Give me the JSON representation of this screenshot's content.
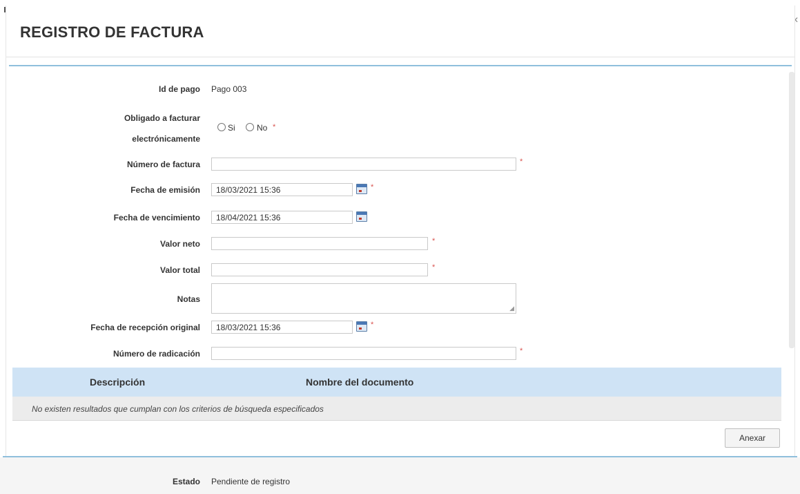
{
  "dialog": {
    "title": "REGISTRO DE FACTURA"
  },
  "fields": {
    "id_pago": {
      "label": "Id de pago",
      "value": "Pago 003"
    },
    "obligado": {
      "label_line1": "Obligado a facturar",
      "label_line2": "electrónicamente",
      "option_si": "Si",
      "option_no": "No"
    },
    "numero_factura": {
      "label": "Número de factura",
      "value": ""
    },
    "fecha_emision": {
      "label": "Fecha de emisión",
      "value": "18/03/2021 15:36"
    },
    "fecha_vencimiento": {
      "label": "Fecha de vencimiento",
      "value": "18/04/2021 15:36"
    },
    "valor_neto": {
      "label": "Valor neto",
      "value": ""
    },
    "valor_total": {
      "label": "Valor total",
      "value": ""
    },
    "notas": {
      "label": "Notas",
      "value": ""
    },
    "fecha_recepcion": {
      "label": "Fecha de recepción original",
      "value": "18/03/2021 15:36"
    },
    "numero_radicacion": {
      "label": "Número de radicación",
      "value": ""
    }
  },
  "required_mark": "*",
  "documents_table": {
    "columns": [
      "Descripción",
      "Nombre del documento"
    ],
    "empty_message": "No existen resultados que cumplan con los criterios de búsqueda especificados"
  },
  "actions": {
    "attach_label": "Anexar"
  },
  "status": {
    "label": "Estado",
    "value": "Pendiente de registro"
  },
  "colors": {
    "table_header": "#cfe3f5",
    "separator_blue": "#8fbfdc",
    "required_red": "#d9534f"
  },
  "icons": {
    "calendar": "calendar-icon",
    "close": "close-icon"
  }
}
